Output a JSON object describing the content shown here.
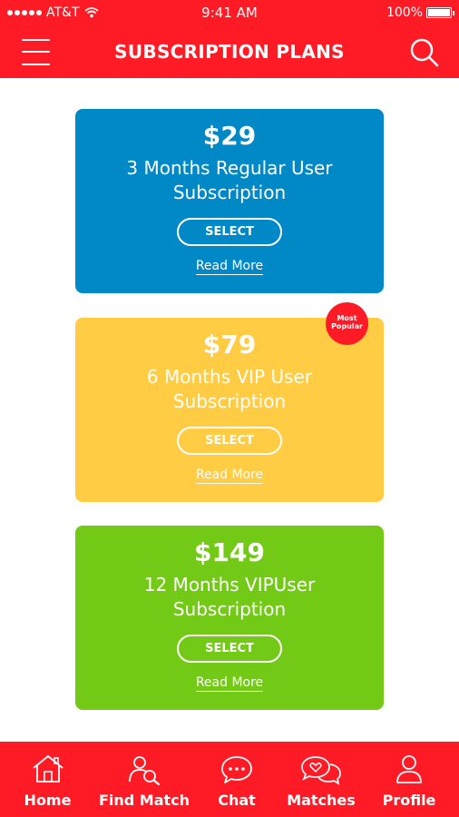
{
  "status_bar": {
    "carrier": "AT&T",
    "time": "9:41 AM",
    "battery": "100%"
  },
  "header": {
    "title": "SUBSCRIPTION PLANS"
  },
  "plans": [
    {
      "price": "$29",
      "name": "3 Months Regular User Subscription",
      "select_label": "SELECT",
      "read_more": "Read More",
      "color": "#0088c7"
    },
    {
      "price": "$79",
      "name": "6 Months VIP User Subscription",
      "select_label": "SELECT",
      "read_more": "Read More",
      "color": "#ffcc44",
      "badge_line1": "Most",
      "badge_line2": "Popular"
    },
    {
      "price": "$149",
      "name": "12 Months VIPUser Subscription",
      "select_label": "SELECT",
      "read_more": "Read More",
      "color": "#72c916"
    }
  ],
  "bottom_nav": [
    {
      "label": "Home",
      "icon": "home-icon"
    },
    {
      "label": "Find Match",
      "icon": "find-match-icon"
    },
    {
      "label": "Chat",
      "icon": "chat-icon"
    },
    {
      "label": "Matches",
      "icon": "matches-icon"
    },
    {
      "label": "Profile",
      "icon": "profile-icon"
    }
  ],
  "colors": {
    "accent": "#fe1b26",
    "background": "#ffffff"
  }
}
